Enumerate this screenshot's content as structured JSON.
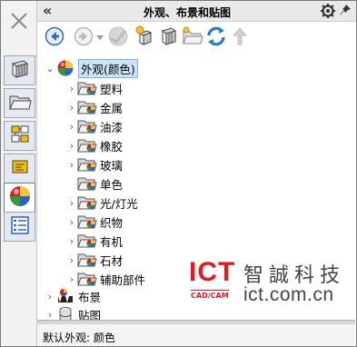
{
  "header": {
    "title": "外观、布景和贴图",
    "collapse_glyph": "«"
  },
  "tabs": [
    {
      "icon": "close-icon"
    },
    {
      "icon": "feature-manager-icon"
    },
    {
      "icon": "property-manager-icon"
    },
    {
      "icon": "configuration-manager-icon"
    },
    {
      "icon": "dim-xpert-icon"
    },
    {
      "icon": "appearances-icon",
      "active": true
    },
    {
      "icon": "display-manager-icon"
    }
  ],
  "toolbar": {
    "buttons": [
      "back-icon",
      "forward-icon",
      "refresh-disabled-icon",
      "add-appearance-icon",
      "add-library-icon",
      "add-folder-icon",
      "reload-icon",
      "move-up-icon"
    ]
  },
  "tree": {
    "root": {
      "label": "外观(颜色)",
      "expanded": true
    },
    "folders": [
      "塑料",
      "金属",
      "油漆",
      "橡胶",
      "玻璃",
      "单色",
      "光/灯光",
      "织物",
      "有机",
      "石材",
      "辅助部件"
    ],
    "expandable": [
      true,
      true,
      true,
      true,
      true,
      false,
      true,
      true,
      true,
      true,
      true
    ],
    "scenes": {
      "label": "布景"
    },
    "decals": {
      "label": "贴图"
    }
  },
  "watermark": {
    "logo": "ICT",
    "logo_sub": "CAD/CAM",
    "cn": "智誠科技",
    "url": "ict.com.cn"
  },
  "status": {
    "text": "默认外观: 颜色"
  },
  "colors": {
    "accent": "#1e7ad6",
    "watermark_red": "#e7191f"
  }
}
